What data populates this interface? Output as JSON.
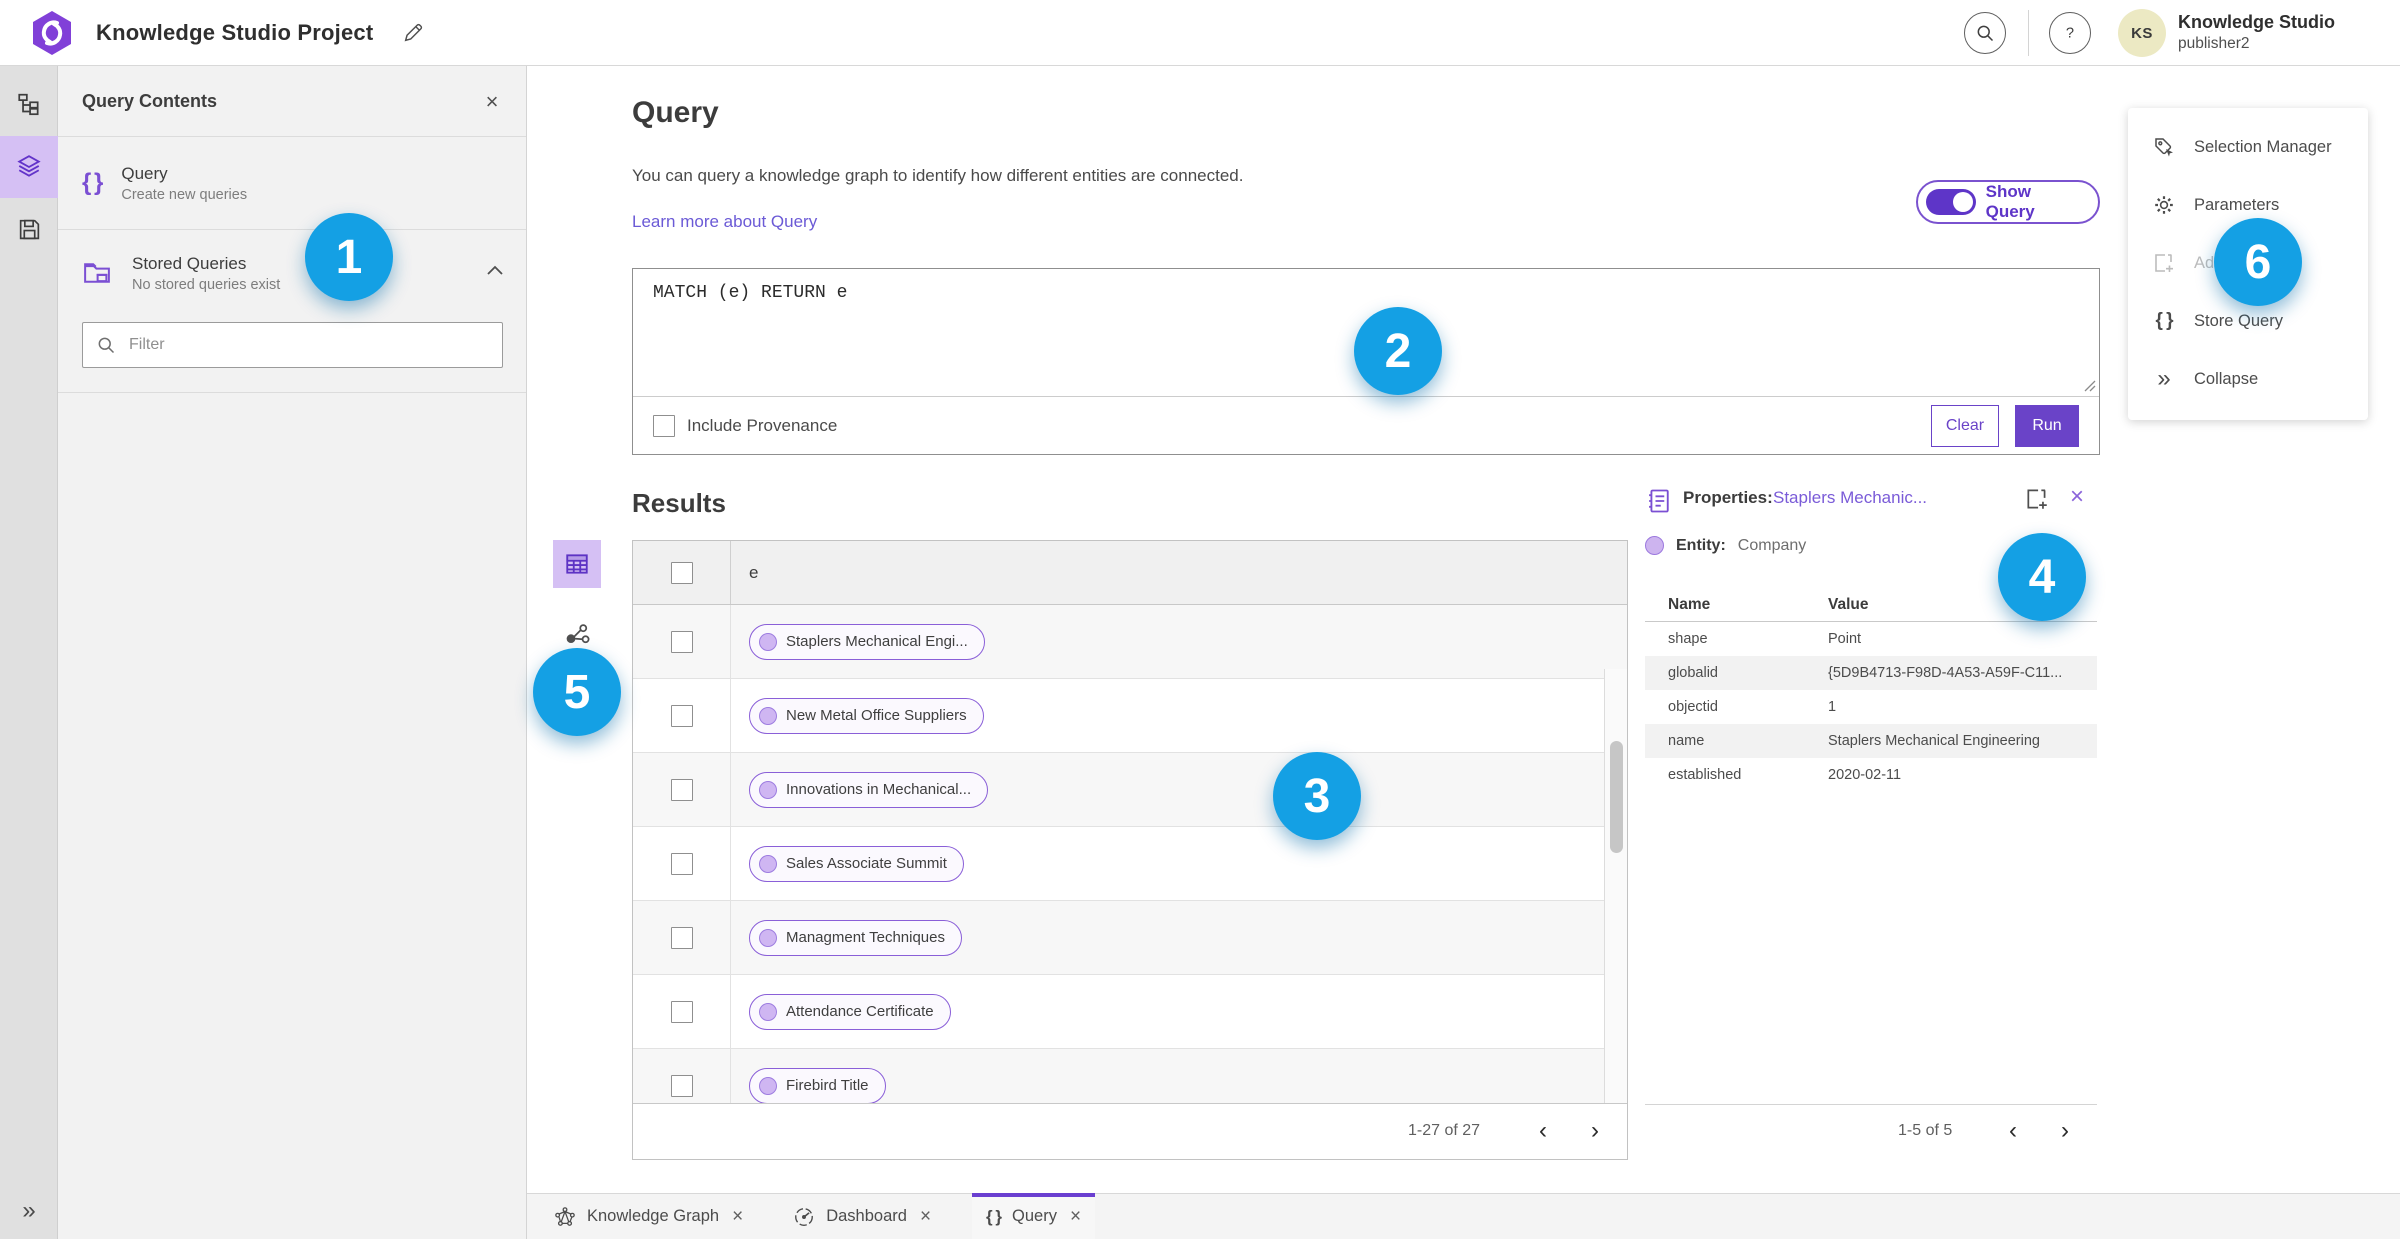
{
  "topbar": {
    "title": "Knowledge Studio Project",
    "user_name": "Knowledge Studio",
    "user_role": "publisher2",
    "avatar_initials": "KS"
  },
  "sidebar_panel": {
    "title": "Query Contents",
    "query_item": {
      "title": "Query",
      "subtitle": "Create new queries"
    },
    "stored_queries": {
      "title": "Stored Queries",
      "subtitle": "No stored queries exist"
    },
    "filter_placeholder": "Filter"
  },
  "query": {
    "heading": "Query",
    "description": "You can query a knowledge graph to identify how different entities are connected.",
    "learn_link": "Learn more about Query",
    "show_query_label": "Show Query",
    "query_text": "MATCH (e) RETURN e",
    "include_provenance": "Include Provenance",
    "clear": "Clear",
    "run": "Run"
  },
  "results": {
    "heading": "Results",
    "column_e": "e",
    "rows": [
      "Staplers Mechanical Engi...",
      "New Metal Office Suppliers",
      "Innovations in Mechanical...",
      "Sales Associate Summit",
      "Managment Techniques",
      "Attendance Certificate",
      "Firebird Title"
    ],
    "pagination": "1-27 of 27"
  },
  "properties": {
    "label": "Properties:",
    "selected_entity": "Staplers Mechanic...",
    "entity_label": "Entity:",
    "entity_type": "Company",
    "col_name": "Name",
    "col_value": "Value",
    "rows": [
      {
        "name": "shape",
        "value": "Point"
      },
      {
        "name": "globalid",
        "value": "{5D9B4713-F98D-4A53-A59F-C11..."
      },
      {
        "name": "objectid",
        "value": "1"
      },
      {
        "name": "name",
        "value": "Staplers Mechanical Engineering"
      },
      {
        "name": "established",
        "value": "2020-02-11"
      }
    ],
    "pagination": "1-5 of 5"
  },
  "right_menu": {
    "items": [
      {
        "label": "Selection Manager"
      },
      {
        "label": "Parameters"
      },
      {
        "label": "Add To Map"
      },
      {
        "label": "Store Query"
      },
      {
        "label": "Collapse"
      }
    ]
  },
  "tabs": [
    {
      "label": "Knowledge Graph"
    },
    {
      "label": "Dashboard"
    },
    {
      "label": "Query"
    }
  ],
  "badges": [
    "1",
    "2",
    "3",
    "4",
    "5",
    "6"
  ],
  "icons": {
    "close": "×",
    "chevron_left": "‹",
    "chevron_right": "›",
    "collapse": "»",
    "braces": "{ }"
  },
  "colors": {
    "accent_purple": "#6a43c8",
    "light_purple": "#d5c0f4",
    "link_purple": "#6b5ad6",
    "badge_blue": "#14a0e4"
  }
}
